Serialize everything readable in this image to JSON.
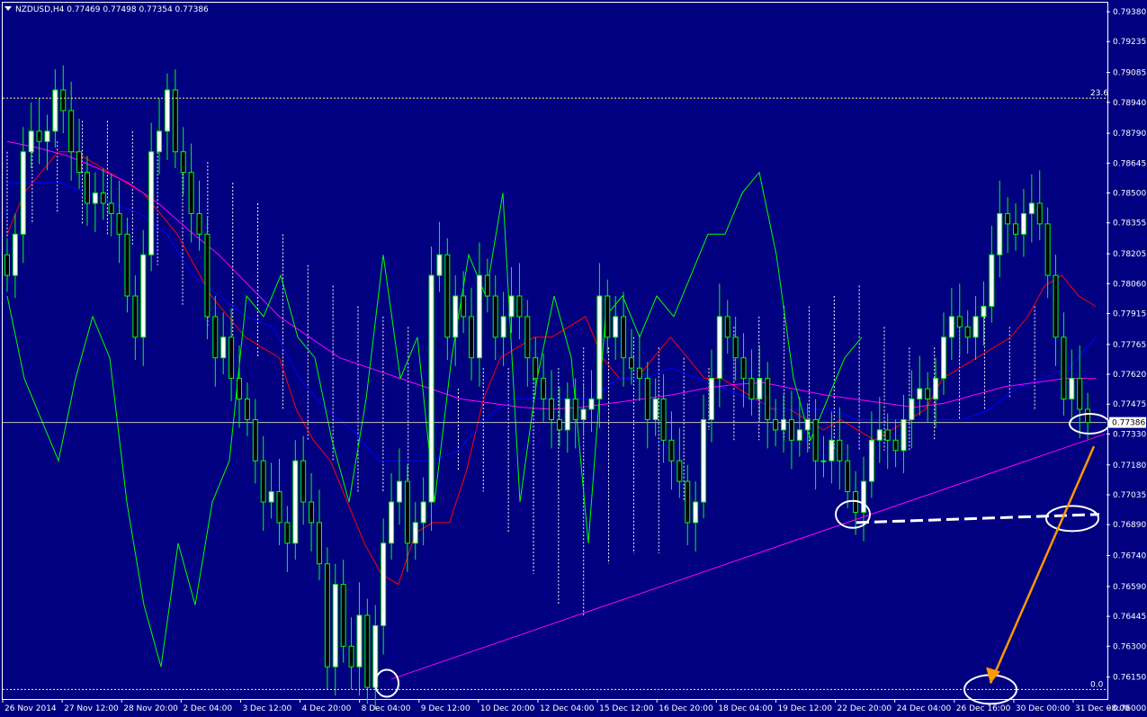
{
  "header": {
    "symbol_tf": "NZDUSD,H4",
    "ohlc": "0.77469 0.77498 0.77354 0.77386"
  },
  "price_tag": "0.77386",
  "fib_levels": [
    {
      "label": "23.6",
      "price": 0.7896
    },
    {
      "label": "0.0",
      "price": 0.7609
    }
  ],
  "colors": {
    "background": "#000080",
    "grid_border": "#ffffff",
    "bull_candle": "#ffffff",
    "bear_candle": "#000000",
    "wick": "#00ff00",
    "tenkan": "#ff0000",
    "kijun": "#0000ff",
    "chikou": "#00ff00",
    "ma": "#ff00ff",
    "cloud": "#ffffff",
    "arrow": "#ff9900",
    "trendline": "#ff00ff"
  },
  "chart_data": {
    "type": "line",
    "title": "NZDUSD,H4",
    "ylim": [
      0.76,
      0.7938
    ],
    "y_ticks": [
      "0.79380",
      "0.79235",
      "0.79085",
      "0.78940",
      "0.78790",
      "0.78645",
      "0.78500",
      "0.78355",
      "0.78205",
      "0.78060",
      "0.77915",
      "0.77765",
      "0.77620",
      "0.77475",
      "0.77330",
      "0.77180",
      "0.77035",
      "0.76890",
      "0.76740",
      "0.76590",
      "0.76445",
      "0.76300",
      "0.76150",
      "0.76000"
    ],
    "x_ticks": [
      "26 Nov 2014",
      "27 Nov 12:00",
      "28 Nov 20:00",
      "2 Dec 04:00",
      "3 Dec 12:00",
      "4 Dec 20:00",
      "8 Dec 04:00",
      "9 Dec 12:00",
      "10 Dec 20:00",
      "12 Dec 04:00",
      "15 Dec 12:00",
      "16 Dec 20:00",
      "18 Dec 04:00",
      "19 Dec 12:00",
      "22 Dec 20:00",
      "24 Dec 04:00",
      "26 Dec 16:00",
      "30 Dec 00:00",
      "31 Dec 08:00"
    ],
    "current_price": 0.77386,
    "close": [
      0.781,
      0.783,
      0.787,
      0.788,
      0.7875,
      0.788,
      0.79,
      0.789,
      0.787,
      0.786,
      0.7845,
      0.785,
      0.7845,
      0.784,
      0.783,
      0.78,
      0.778,
      0.782,
      0.787,
      0.788,
      0.79,
      0.787,
      0.786,
      0.784,
      0.783,
      0.779,
      0.777,
      0.778,
      0.776,
      0.775,
      0.774,
      0.772,
      0.77,
      0.7705,
      0.769,
      0.768,
      0.772,
      0.77,
      0.769,
      0.767,
      0.762,
      0.766,
      0.763,
      0.762,
      0.7645,
      0.761,
      0.764,
      0.768,
      0.77,
      0.771,
      0.768,
      0.769,
      0.77,
      0.781,
      0.782,
      0.778,
      0.78,
      0.779,
      0.777,
      0.781,
      0.78,
      0.778,
      0.779,
      0.78,
      0.779,
      0.777,
      0.776,
      0.775,
      0.774,
      0.7735,
      0.775,
      0.774,
      0.7745,
      0.775,
      0.78,
      0.778,
      0.779,
      0.777,
      0.7765,
      0.776,
      0.774,
      0.775,
      0.773,
      0.772,
      0.771,
      0.769,
      0.77,
      0.774,
      0.776,
      0.779,
      0.778,
      0.777,
      0.776,
      0.775,
      0.776,
      0.774,
      0.7735,
      0.774,
      0.773,
      0.7735,
      0.774,
      0.772,
      0.772,
      0.773,
      0.772,
      0.7705,
      0.7695,
      0.771,
      0.773,
      0.7735,
      0.773,
      0.7725,
      0.774,
      0.775,
      0.7755,
      0.775,
      0.776,
      0.778,
      0.779,
      0.7785,
      0.778,
      0.779,
      0.7795,
      0.782,
      0.784,
      0.7835,
      0.783,
      0.784,
      0.7845,
      0.7835,
      0.781,
      0.778,
      0.775,
      0.776,
      0.7745,
      0.77386
    ],
    "series": [
      {
        "name": "Tenkan-sen",
        "values": [
          0.783,
          0.785,
          0.786,
          0.787,
          0.787,
          0.7865,
          0.786,
          0.7855,
          0.785,
          0.784,
          0.783,
          0.7815,
          0.78,
          0.779,
          0.778,
          0.7775,
          0.777,
          0.7745,
          0.773,
          0.772,
          0.77,
          0.768,
          0.7665,
          0.766,
          0.7685,
          0.769,
          0.769,
          0.7715,
          0.775,
          0.777,
          0.7775,
          0.778,
          0.778,
          0.7785,
          0.779,
          0.777,
          0.776,
          0.776,
          0.777,
          0.778,
          0.777,
          0.776,
          0.776,
          0.7755,
          0.775,
          0.7745,
          0.7745,
          0.774,
          0.7735,
          0.774,
          0.7735,
          0.773,
          0.7735,
          0.774,
          0.7745,
          0.776,
          0.7765,
          0.777,
          0.7775,
          0.778,
          0.779,
          0.7805,
          0.781,
          0.78,
          0.7795
        ]
      },
      {
        "name": "Kijun-sen",
        "values": [
          0.7855,
          0.7855,
          0.7855,
          0.785,
          0.7845,
          0.784,
          0.783,
          0.781,
          0.78,
          0.779,
          0.7785,
          0.776,
          0.7745,
          0.7735,
          0.772,
          0.772,
          0.772,
          0.7725,
          0.774,
          0.775,
          0.775,
          0.775,
          0.775,
          0.776,
          0.776,
          0.7765,
          0.776,
          0.7755,
          0.775,
          0.7745,
          0.7745,
          0.7745,
          0.774,
          0.774,
          0.774,
          0.774,
          0.774,
          0.7745,
          0.7755,
          0.776,
          0.7765,
          0.778
        ]
      },
      {
        "name": "MA",
        "values": [
          0.7875,
          0.7872,
          0.7868,
          0.7862,
          0.7855,
          0.7845,
          0.7832,
          0.782,
          0.7805,
          0.779,
          0.778,
          0.777,
          0.7765,
          0.776,
          0.7755,
          0.775,
          0.7748,
          0.7746,
          0.7745,
          0.7746,
          0.7748,
          0.775,
          0.7752,
          0.7755,
          0.7757,
          0.7758,
          0.7755,
          0.7752,
          0.775,
          0.7748,
          0.7746,
          0.7748,
          0.7752,
          0.7756,
          0.7758,
          0.776,
          0.776
        ]
      },
      {
        "name": "Chikou",
        "values": [
          0.78,
          0.776,
          0.774,
          0.772,
          0.776,
          0.779,
          0.777,
          0.77,
          0.765,
          0.762,
          0.768,
          0.765,
          0.77,
          0.772,
          0.78,
          0.779,
          0.781,
          0.778,
          0.777,
          0.773,
          0.77,
          0.775,
          0.782,
          0.776,
          0.778,
          0.77,
          0.777,
          0.782,
          0.78,
          0.785,
          0.77,
          0.776,
          0.78,
          0.777,
          0.768,
          0.779,
          0.78,
          0.778,
          0.78,
          0.779,
          0.781,
          0.783,
          0.783,
          0.785,
          0.786,
          0.782,
          0.776,
          0.773,
          0.775,
          0.777,
          0.778
        ]
      }
    ]
  }
}
